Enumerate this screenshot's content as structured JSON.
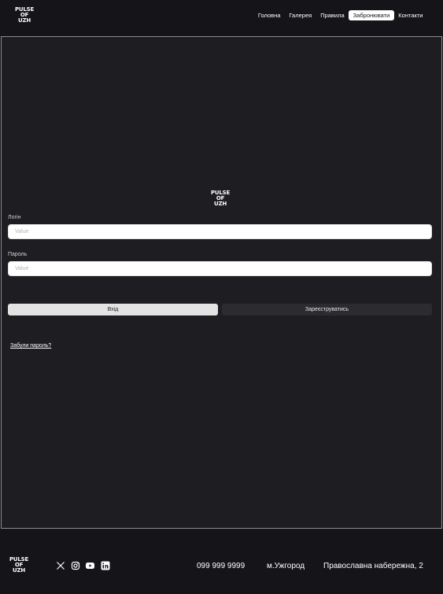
{
  "brand": {
    "logo_line1": "PULSE",
    "logo_line2": "OF",
    "logo_line3": "UZH"
  },
  "nav": {
    "items": [
      {
        "label": "Головна",
        "icon": ""
      },
      {
        "label": "Галерея",
        "icon": ""
      },
      {
        "label": "Правила",
        "icon": ""
      },
      {
        "label": "Забронювати",
        "active": true
      },
      {
        "label": "Контакти",
        "icon": ""
      }
    ]
  },
  "form": {
    "login_label": "Логін",
    "login_placeholder": "Value",
    "password_label": "Пароль",
    "password_placeholder": "Value",
    "login_button": "Вхід",
    "register_button": "Зареєструватись",
    "forgot_link": "Забули пароль?"
  },
  "footer": {
    "socials": [
      "x-icon",
      "instagram-icon",
      "youtube-icon",
      "linkedin-icon"
    ],
    "phone": "099 999 9999",
    "city": "м.Ужгород",
    "address": "Православна набережна, 2"
  },
  "colors": {
    "background": "#151418",
    "panel": "#1e1d21",
    "panel_border": "#8d8c91",
    "accent_active_nav": "#ffffff"
  }
}
